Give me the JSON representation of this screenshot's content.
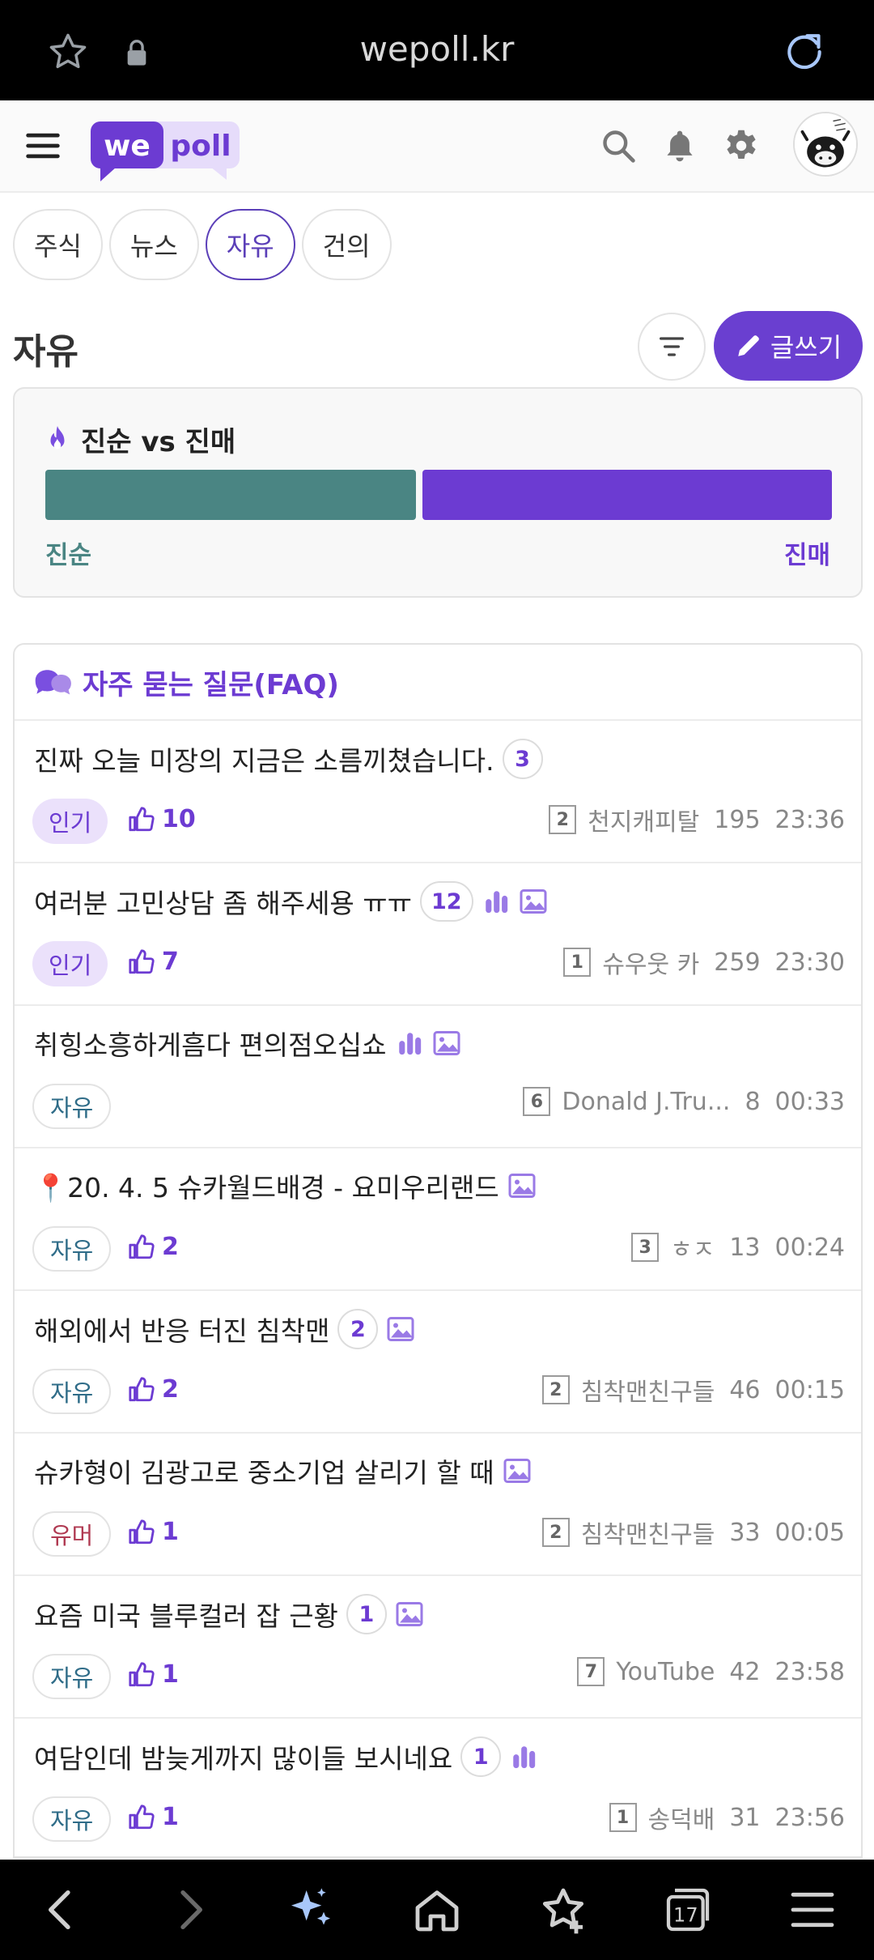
{
  "browser": {
    "url": "wepoll.kr",
    "tab_count": "17"
  },
  "header": {
    "logo_we": "we",
    "logo_poll": "poll"
  },
  "tabs": [
    {
      "label": "주식"
    },
    {
      "label": "뉴스"
    },
    {
      "label": "자유"
    },
    {
      "label": "건의"
    }
  ],
  "board": {
    "title": "자유",
    "write_label": "글쓰기"
  },
  "poll": {
    "title": "진순 vs 진매",
    "left_label": "진순",
    "right_label": "진매",
    "left_share": 0.47,
    "colors": {
      "left": "#4a8583",
      "right": "#6c3bd2"
    }
  },
  "faq": {
    "label": "자주 묻는 질문(FAQ)"
  },
  "posts": [
    {
      "title": "진짜 오늘 미장의 지금은 소름끼쳤습니다.",
      "comments": "3",
      "tag": "인기",
      "likes": "10",
      "level": "2",
      "author": "천지캐피탈",
      "views": "195",
      "time": "23:36"
    },
    {
      "title": "여러분 고민상담 좀 해주세용 ㅠㅠ",
      "comments": "12",
      "tag": "인기",
      "likes": "7",
      "level": "1",
      "author": "슈우웃 카",
      "views": "259",
      "time": "23:30"
    },
    {
      "title": "취힝소흥하게흠다 편의점오십쇼",
      "comments": "",
      "tag": "자유",
      "likes": "",
      "level": "6",
      "author": "Donald J.Tru...",
      "views": "8",
      "time": "00:33"
    },
    {
      "title": "📍20. 4. 5 슈카월드배경 - 요미우리랜드",
      "comments": "",
      "tag": "자유",
      "likes": "2",
      "level": "3",
      "author": "ㅎㅈ",
      "views": "13",
      "time": "00:24"
    },
    {
      "title": "해외에서 반응 터진 침착맨",
      "comments": "2",
      "tag": "자유",
      "likes": "2",
      "level": "2",
      "author": "침착맨친구들",
      "views": "46",
      "time": "00:15"
    },
    {
      "title": "슈카형이 김광고로 중소기업 살리기 할 때",
      "comments": "",
      "tag": "유머",
      "likes": "1",
      "level": "2",
      "author": "침착맨친구들",
      "views": "33",
      "time": "00:05"
    },
    {
      "title": "요즘 미국 블루컬러 잡 근황",
      "comments": "1",
      "tag": "자유",
      "likes": "1",
      "level": "7",
      "author": "YouTube",
      "views": "42",
      "time": "23:58"
    },
    {
      "title": "여담인데 밤늦게까지 많이들 보시네요",
      "comments": "1",
      "tag": "자유",
      "likes": "1",
      "level": "1",
      "author": "송덕배",
      "views": "31",
      "time": "23:56"
    }
  ]
}
